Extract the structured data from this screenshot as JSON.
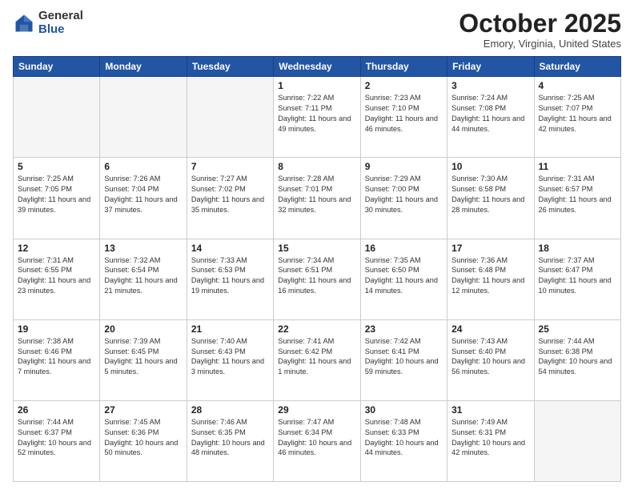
{
  "logo": {
    "general": "General",
    "blue": "Blue"
  },
  "header": {
    "month": "October 2025",
    "location": "Emory, Virginia, United States"
  },
  "days_of_week": [
    "Sunday",
    "Monday",
    "Tuesday",
    "Wednesday",
    "Thursday",
    "Friday",
    "Saturday"
  ],
  "weeks": [
    [
      {
        "day": "",
        "info": ""
      },
      {
        "day": "",
        "info": ""
      },
      {
        "day": "",
        "info": ""
      },
      {
        "day": "1",
        "info": "Sunrise: 7:22 AM\nSunset: 7:11 PM\nDaylight: 11 hours\nand 49 minutes."
      },
      {
        "day": "2",
        "info": "Sunrise: 7:23 AM\nSunset: 7:10 PM\nDaylight: 11 hours\nand 46 minutes."
      },
      {
        "day": "3",
        "info": "Sunrise: 7:24 AM\nSunset: 7:08 PM\nDaylight: 11 hours\nand 44 minutes."
      },
      {
        "day": "4",
        "info": "Sunrise: 7:25 AM\nSunset: 7:07 PM\nDaylight: 11 hours\nand 42 minutes."
      }
    ],
    [
      {
        "day": "5",
        "info": "Sunrise: 7:25 AM\nSunset: 7:05 PM\nDaylight: 11 hours\nand 39 minutes."
      },
      {
        "day": "6",
        "info": "Sunrise: 7:26 AM\nSunset: 7:04 PM\nDaylight: 11 hours\nand 37 minutes."
      },
      {
        "day": "7",
        "info": "Sunrise: 7:27 AM\nSunset: 7:02 PM\nDaylight: 11 hours\nand 35 minutes."
      },
      {
        "day": "8",
        "info": "Sunrise: 7:28 AM\nSunset: 7:01 PM\nDaylight: 11 hours\nand 32 minutes."
      },
      {
        "day": "9",
        "info": "Sunrise: 7:29 AM\nSunset: 7:00 PM\nDaylight: 11 hours\nand 30 minutes."
      },
      {
        "day": "10",
        "info": "Sunrise: 7:30 AM\nSunset: 6:58 PM\nDaylight: 11 hours\nand 28 minutes."
      },
      {
        "day": "11",
        "info": "Sunrise: 7:31 AM\nSunset: 6:57 PM\nDaylight: 11 hours\nand 26 minutes."
      }
    ],
    [
      {
        "day": "12",
        "info": "Sunrise: 7:31 AM\nSunset: 6:55 PM\nDaylight: 11 hours\nand 23 minutes."
      },
      {
        "day": "13",
        "info": "Sunrise: 7:32 AM\nSunset: 6:54 PM\nDaylight: 11 hours\nand 21 minutes."
      },
      {
        "day": "14",
        "info": "Sunrise: 7:33 AM\nSunset: 6:53 PM\nDaylight: 11 hours\nand 19 minutes."
      },
      {
        "day": "15",
        "info": "Sunrise: 7:34 AM\nSunset: 6:51 PM\nDaylight: 11 hours\nand 16 minutes."
      },
      {
        "day": "16",
        "info": "Sunrise: 7:35 AM\nSunset: 6:50 PM\nDaylight: 11 hours\nand 14 minutes."
      },
      {
        "day": "17",
        "info": "Sunrise: 7:36 AM\nSunset: 6:48 PM\nDaylight: 11 hours\nand 12 minutes."
      },
      {
        "day": "18",
        "info": "Sunrise: 7:37 AM\nSunset: 6:47 PM\nDaylight: 11 hours\nand 10 minutes."
      }
    ],
    [
      {
        "day": "19",
        "info": "Sunrise: 7:38 AM\nSunset: 6:46 PM\nDaylight: 11 hours\nand 7 minutes."
      },
      {
        "day": "20",
        "info": "Sunrise: 7:39 AM\nSunset: 6:45 PM\nDaylight: 11 hours\nand 5 minutes."
      },
      {
        "day": "21",
        "info": "Sunrise: 7:40 AM\nSunset: 6:43 PM\nDaylight: 11 hours\nand 3 minutes."
      },
      {
        "day": "22",
        "info": "Sunrise: 7:41 AM\nSunset: 6:42 PM\nDaylight: 11 hours\nand 1 minute."
      },
      {
        "day": "23",
        "info": "Sunrise: 7:42 AM\nSunset: 6:41 PM\nDaylight: 10 hours\nand 59 minutes."
      },
      {
        "day": "24",
        "info": "Sunrise: 7:43 AM\nSunset: 6:40 PM\nDaylight: 10 hours\nand 56 minutes."
      },
      {
        "day": "25",
        "info": "Sunrise: 7:44 AM\nSunset: 6:38 PM\nDaylight: 10 hours\nand 54 minutes."
      }
    ],
    [
      {
        "day": "26",
        "info": "Sunrise: 7:44 AM\nSunset: 6:37 PM\nDaylight: 10 hours\nand 52 minutes."
      },
      {
        "day": "27",
        "info": "Sunrise: 7:45 AM\nSunset: 6:36 PM\nDaylight: 10 hours\nand 50 minutes."
      },
      {
        "day": "28",
        "info": "Sunrise: 7:46 AM\nSunset: 6:35 PM\nDaylight: 10 hours\nand 48 minutes."
      },
      {
        "day": "29",
        "info": "Sunrise: 7:47 AM\nSunset: 6:34 PM\nDaylight: 10 hours\nand 46 minutes."
      },
      {
        "day": "30",
        "info": "Sunrise: 7:48 AM\nSunset: 6:33 PM\nDaylight: 10 hours\nand 44 minutes."
      },
      {
        "day": "31",
        "info": "Sunrise: 7:49 AM\nSunset: 6:31 PM\nDaylight: 10 hours\nand 42 minutes."
      },
      {
        "day": "",
        "info": ""
      }
    ]
  ]
}
